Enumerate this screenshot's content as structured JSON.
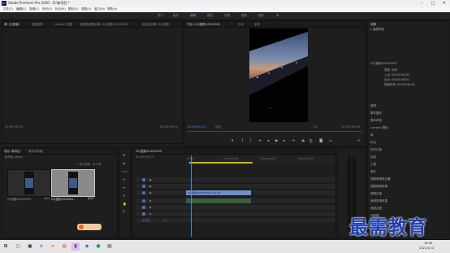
{
  "window": {
    "title": "Adobe Premiere Pro 2020 - D:\\新项目 *",
    "app_icon": "Pr"
  },
  "menu": [
    "文件(F)",
    "编辑(E)",
    "剪辑(C)",
    "序列(S)",
    "标记(M)",
    "图形(G)",
    "视图(V)",
    "窗口(W)",
    "帮助(H)"
  ],
  "workspaces": [
    {
      "label": "学习",
      "active": false
    },
    {
      "label": "组件",
      "active": false
    },
    {
      "label": "编辑",
      "active": true
    },
    {
      "label": "颜色",
      "active": false
    },
    {
      "label": "效果",
      "active": false
    },
    {
      "label": "音频",
      "active": false
    },
    {
      "label": "图形",
      "active": false
    },
    {
      "label": "库",
      "active": false
    }
  ],
  "source_panel": {
    "tabs": [
      "源: (无剪辑)",
      "效果控件",
      "Lumetri 范围",
      "音频剪辑混合器: 02(竖屏)20200509",
      "音轨混合器: 02(竖屏)"
    ],
    "timecode_left": "00;00;00;00",
    "timecode_right": "00;00;00;00"
  },
  "program_panel": {
    "tab": "节目: 02(竖屏)20200509",
    "tabs_extra": [
      "文本",
      "参考"
    ],
    "timecode": "00;00;05;14",
    "fit": "适合",
    "resolution": "1/2",
    "duration": "00;00;08;04"
  },
  "effects_panel": {
    "title": "效果",
    "preset_item": "▸ 速度预设",
    "section_title": "02(竖屏)20200509",
    "info_rows": [
      "类型: 序列",
      "入点: 00;00;00;00",
      "出点: 00;00;08;04",
      "持续时间: 00;00;08;05"
    ],
    "items": [
      "音频",
      "基本图形",
      "基本声音",
      "Lumetri 颜色",
      "库",
      "标记",
      "历史记录",
      "信息",
      "工具",
      "事件",
      "视频剪辑混合器",
      "视频剪辑效果",
      "视频过渡",
      "音频剪辑效果",
      "音频过渡",
      "元数据"
    ]
  },
  "project_panel": {
    "tabs": [
      "项目: 新项目",
      "媒体浏览器"
    ],
    "path": "新项目.prproj",
    "count": "1 项已选择，共 2 项",
    "items": [
      {
        "name": "02(竖屏)20200509",
        "duration": "8;04",
        "selected": false
      },
      {
        "name": "02(竖屏)2020050...",
        "duration": "8;04",
        "selected": true
      }
    ]
  },
  "timeline": {
    "tab": "02(竖屏)20200509",
    "timecode": "00;00;05;14",
    "ruler": [
      ":00;00",
      "00;00;04;29",
      "00;00;09;29",
      "00;00;14;29"
    ],
    "video_tracks": [
      "V3",
      "V2",
      "V1"
    ],
    "audio_tracks": [
      "A1",
      "A2",
      "A3"
    ],
    "master": "主声道",
    "master_value": "0.0",
    "clip_video": "02(竖屏)20200509.mp4 [V]",
    "playhead_fraction": 0.03
  },
  "watermark": "最需教育",
  "taskbar": {
    "time": "16:46",
    "date": "2021/5/14"
  }
}
